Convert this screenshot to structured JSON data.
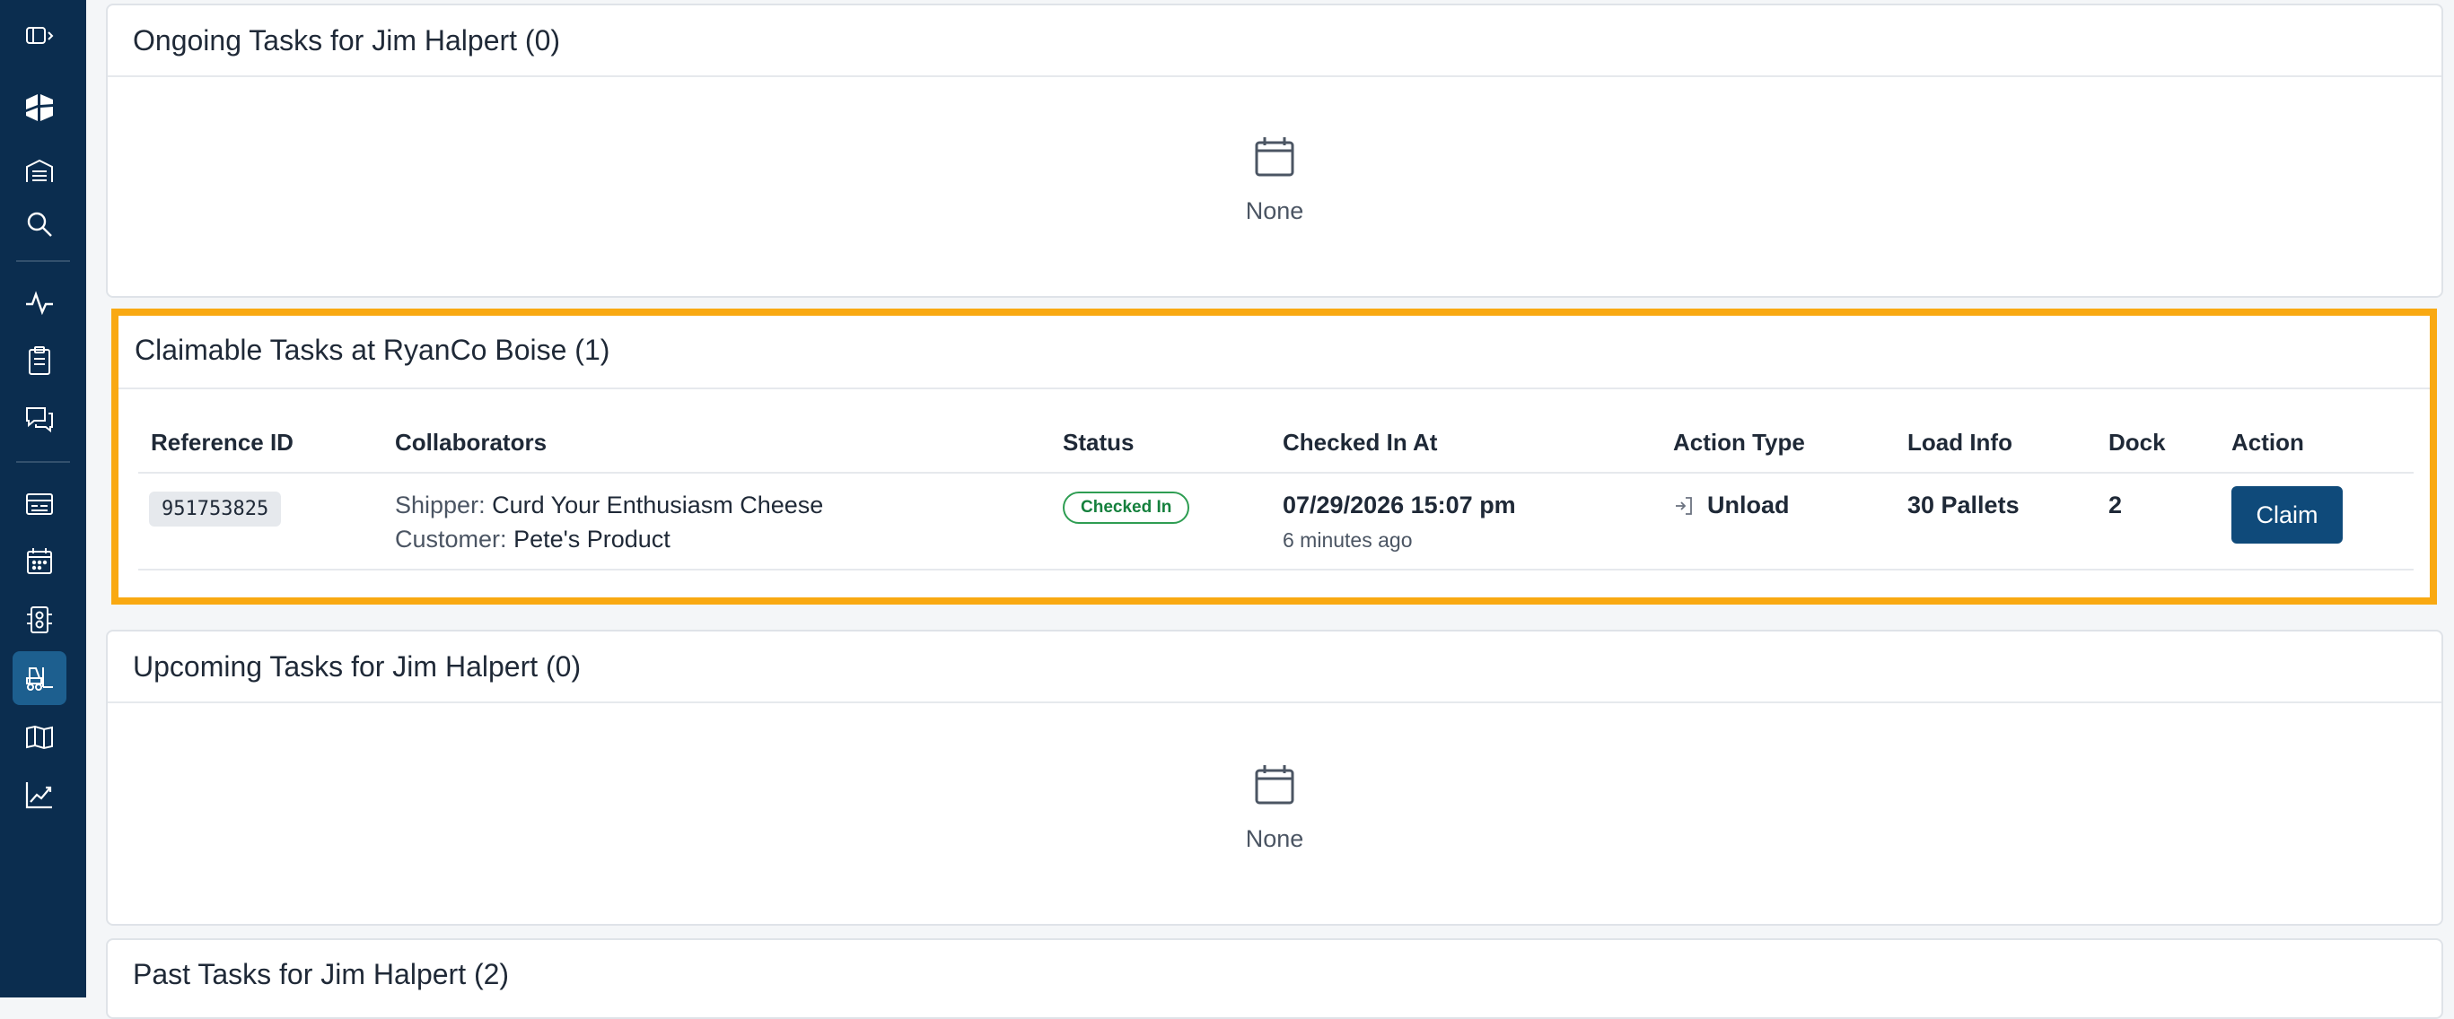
{
  "sidebar": {
    "icons": [
      "sidebar-toggle-icon",
      "logo-icon",
      "warehouse-icon",
      "search-icon",
      "activity-icon",
      "clipboard-icon",
      "chat-icon",
      "card-list-icon",
      "calendar-icon",
      "dock-icon",
      "forklift-icon",
      "map-icon",
      "chart-icon"
    ],
    "active": "forklift-icon"
  },
  "ongoing": {
    "title": "Ongoing Tasks for Jim Halpert (0)",
    "empty_text": "None"
  },
  "claimable": {
    "title": "Claimable Tasks at RyanCo Boise (1)",
    "columns": [
      "Reference ID",
      "Collaborators",
      "Status",
      "Checked In At",
      "Action Type",
      "Load Info",
      "Dock",
      "Action"
    ],
    "row": {
      "reference_id": "951753825",
      "shipper_label": "Shipper:",
      "shipper": "Curd Your Enthusiasm Cheese",
      "customer_label": "Customer:",
      "customer": "Pete's Product",
      "status": "Checked In",
      "checked_in_at": "07/29/2026 15:07 pm",
      "checked_in_ago": "6 minutes ago",
      "action_type": "Unload",
      "load_info": "30 Pallets",
      "dock": "2",
      "action_label": "Claim"
    },
    "highlight_color": "#f9a912"
  },
  "upcoming": {
    "title": "Upcoming Tasks for Jim Halpert (0)",
    "empty_text": "None"
  },
  "past": {
    "title": "Past Tasks for Jim Halpert (2)"
  },
  "colors": {
    "sidebar": "#0b2d4f",
    "primary_button": "#0f4a7a",
    "status_green": "#15803d"
  }
}
